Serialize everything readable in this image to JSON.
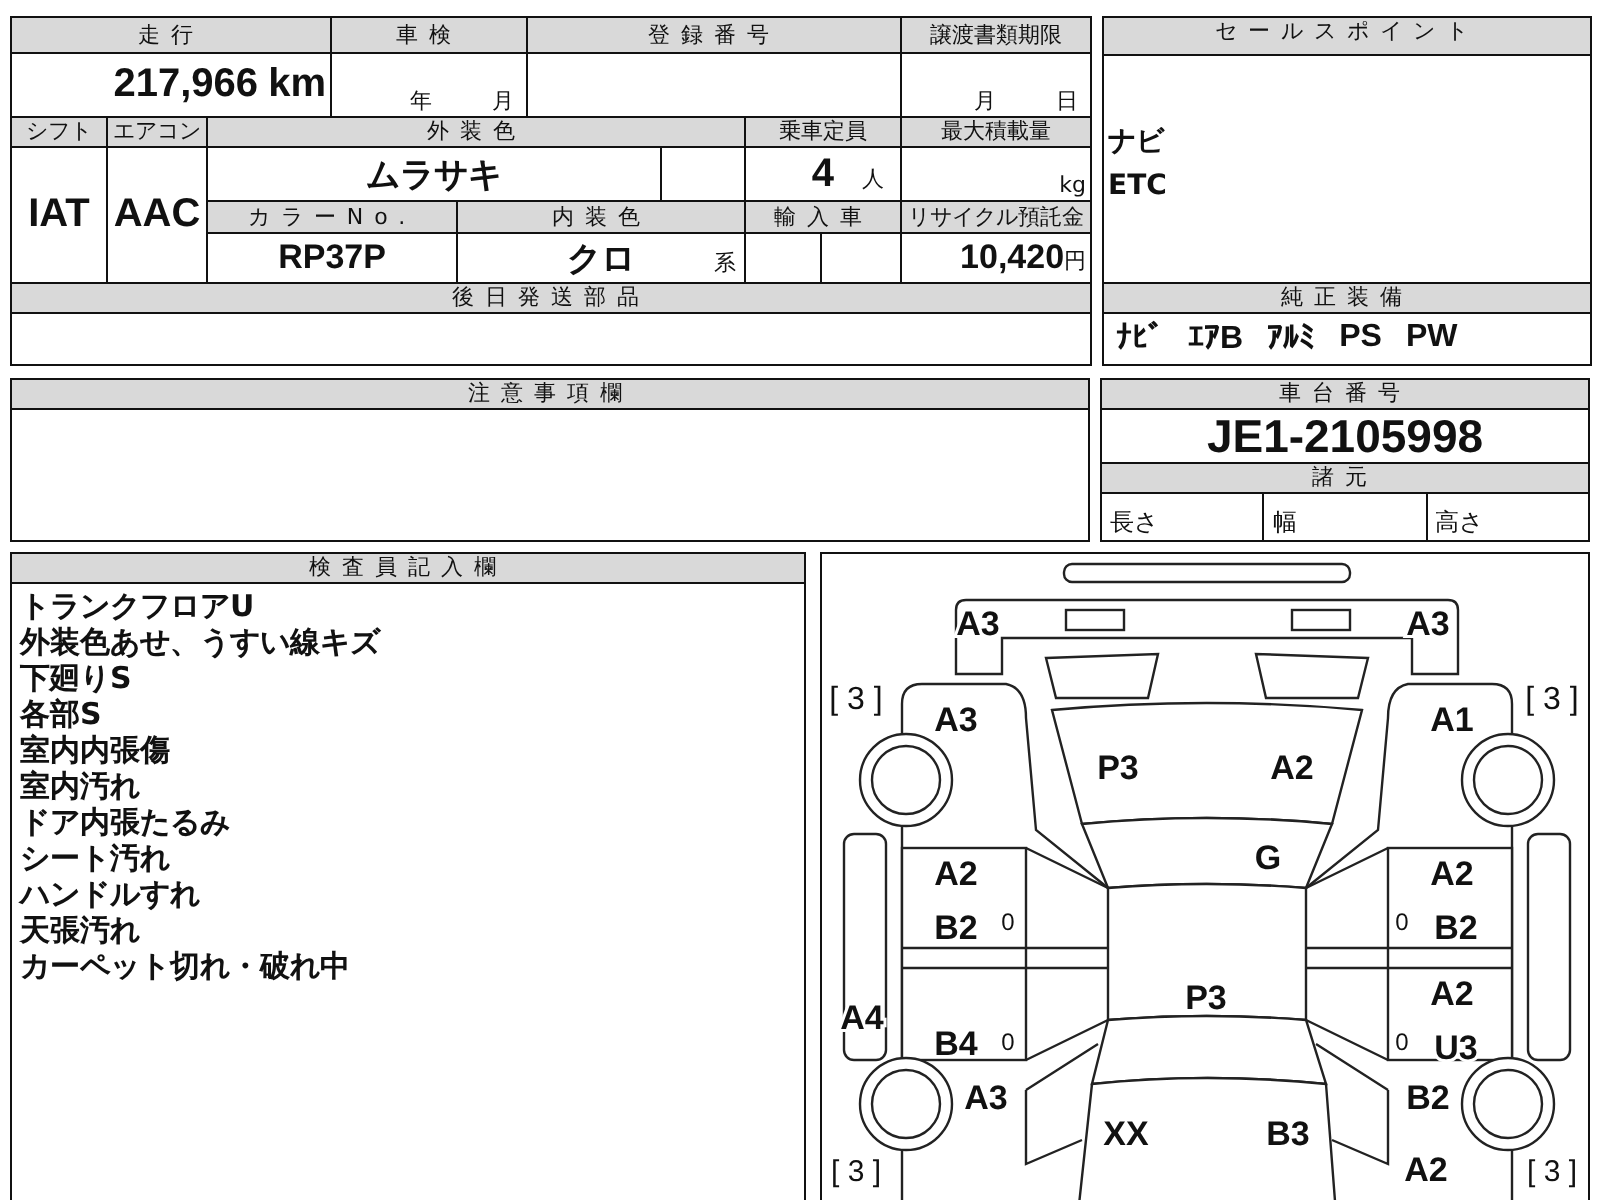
{
  "mileage": {
    "label": "走行",
    "value": "217,966",
    "unit": "km"
  },
  "inspection": {
    "label": "車検",
    "year_unit": "年",
    "month_unit": "月"
  },
  "registration_number": {
    "label": "登録番号"
  },
  "transfer_deadline": {
    "label": "譲渡書類期限",
    "month_unit": "月",
    "day_unit": "日"
  },
  "shift": {
    "label": "シフト",
    "value": "IAT"
  },
  "air_conditioner": {
    "label": "エアコン",
    "value": "AAC"
  },
  "exterior_color": {
    "label": "外装色",
    "value": "ムラサキ"
  },
  "capacity": {
    "label": "乗車定員",
    "value": "4",
    "unit": "人"
  },
  "max_load": {
    "label": "最大積載量",
    "unit": "kg"
  },
  "color_number": {
    "label": "カラーNo.",
    "value": "RP37P"
  },
  "interior_color": {
    "label": "内装色",
    "value": "クロ",
    "suffix": "系"
  },
  "imported": {
    "label": "輸入車"
  },
  "recycling_deposit": {
    "label": "リサイクル預託金",
    "value": "10,420",
    "unit": "円"
  },
  "later_parts": {
    "label": "後日発送部品"
  },
  "sales_points": {
    "label": "セールスポイント",
    "items": [
      "ナビ",
      "ETC"
    ]
  },
  "standard_equipment": {
    "label": "純正装備",
    "items": [
      "ﾅﾋﾞ",
      "ｴｱB",
      "ｱﾙﾐ",
      "PS",
      "PW"
    ]
  },
  "notes": {
    "label": "注意事項欄"
  },
  "chassis_number": {
    "label": "車台番号",
    "value": "JE1-2105998"
  },
  "specs": {
    "label": "諸元",
    "fields": [
      "長さ",
      "幅",
      "高さ"
    ]
  },
  "inspector_notes": {
    "label": "検査員記入欄",
    "lines": [
      "トランクフロアU",
      "外装色あせ、うすい線キズ",
      "下廻りS",
      "各部S",
      "室内内張傷",
      "室内汚れ",
      "ドア内張たるみ",
      "シート汚れ",
      "ハンドルすれ",
      "天張汚れ",
      "カーペット切れ・破れ中"
    ]
  },
  "damage_diagram": {
    "marks": [
      "A3",
      "A3",
      "[ 3 ]",
      "[ 3 ]",
      "A3",
      "A1",
      "P3",
      "A2",
      "G",
      "A2",
      "A2",
      "B2",
      "0",
      "0",
      "B2",
      "P3",
      "A2",
      "A4",
      "B4",
      "0",
      "0",
      "U3",
      "A3",
      "B2",
      "XX",
      "B3",
      "[ 3 ]",
      "A2",
      "[ 3 ]"
    ]
  }
}
